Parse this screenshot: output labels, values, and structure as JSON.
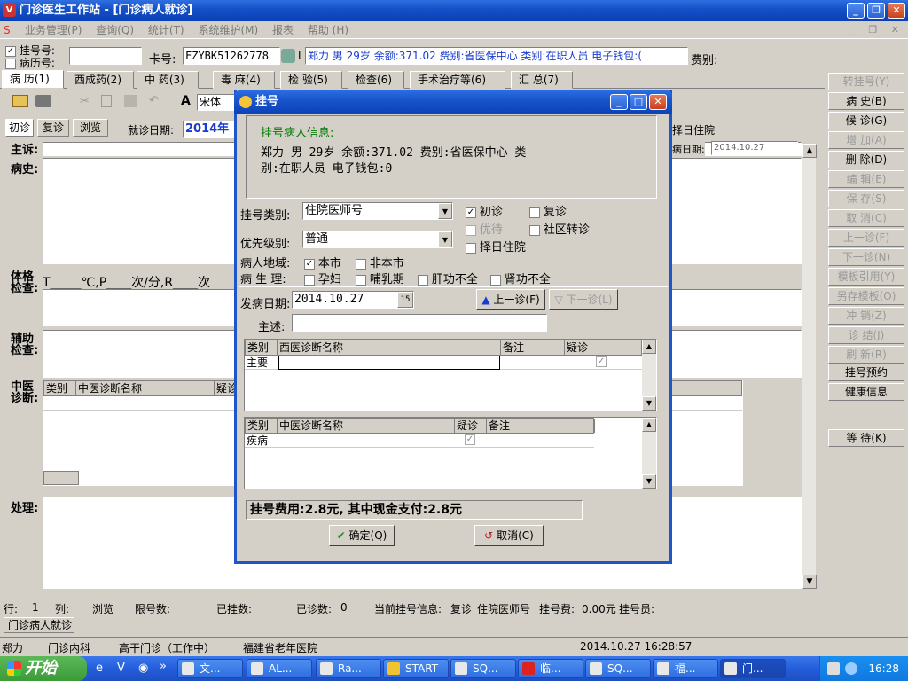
{
  "window": {
    "title": "门诊医生工作站 - [门诊病人就诊]"
  },
  "menu": [
    "业务管理(P)",
    "查询(Q)",
    "统计(T)",
    "系统维护(M)",
    "报表",
    "帮助 (H)"
  ],
  "top": {
    "chk_reg": "挂号号:",
    "chk_record": "病历号:",
    "card_label": "卡号:",
    "card_value": "FZYBK51262778",
    "card_suffix": "I",
    "patient_info": "郑力 男 29岁 余额:371.02 费别:省医保中心 类别:在职人员 电子钱包:(",
    "fee_label": "费别:"
  },
  "tabs": [
    "病 历(1)",
    "西成药(2)",
    "中 药(3)",
    "毒 麻(4)",
    "检 验(5)",
    "检查(6)",
    "手术治疗等(6)",
    "汇 总(7)"
  ],
  "toolbar": {
    "font_name": "宋体"
  },
  "visit": {
    "first": "初诊",
    "return": "复诊",
    "browse": "浏览",
    "date_label": "就诊日期:",
    "date_value": "2014年1",
    "zhuyuan": "择日住院",
    "onset_label": "病日期:",
    "onset_value": "2014.10.27"
  },
  "record": {
    "chief": "主诉:",
    "history": "病史:",
    "physical": "体格检查:",
    "vitals": "T_____℃,P____次/分,R____次",
    "aux": "辅助检查:",
    "tcm": "中医诊断:",
    "tcm_cols": [
      "类别",
      "中医诊断名称",
      "疑诊"
    ],
    "treatment": "处理:"
  },
  "right_buttons": [
    {
      "label": "转挂号(Y)",
      "enabled": false
    },
    {
      "label": "病 史(B)",
      "enabled": true
    },
    {
      "label": "候 诊(G)",
      "enabled": true
    },
    {
      "label": "增 加(A)",
      "enabled": false
    },
    {
      "label": "删 除(D)",
      "enabled": true
    },
    {
      "label": "编 辑(E)",
      "enabled": false
    },
    {
      "label": "保 存(S)",
      "enabled": false
    },
    {
      "label": "取 消(C)",
      "enabled": false
    },
    {
      "label": "上一诊(F)",
      "enabled": false
    },
    {
      "label": "下一诊(N)",
      "enabled": false
    },
    {
      "label": "模板引用(Y)",
      "enabled": false
    },
    {
      "label": "另存模板(O)",
      "enabled": false
    },
    {
      "label": "冲 销(Z)",
      "enabled": false
    },
    {
      "label": "诊 结(J)",
      "enabled": false
    },
    {
      "label": "刷 新(R)",
      "enabled": false
    },
    {
      "label": "挂号预约",
      "enabled": true
    },
    {
      "label": "健康信息",
      "enabled": true
    },
    {
      "label": "等 待(K)",
      "enabled": true
    }
  ],
  "status": {
    "row_label": "行:",
    "row_value": "1",
    "col_label": "列:",
    "mode": "浏览",
    "limit_label": "限号数:",
    "reg_label": "已挂数:",
    "seen_label": "已诊数:",
    "seen_value": "0",
    "cur_label": "当前挂号信息:",
    "cur_value1": "复诊",
    "cur_value2": "住院医师号",
    "fee_label": "挂号费:",
    "fee_value": "0.00元",
    "staff_label": "挂号员:"
  },
  "doc_tab": "门诊病人就诊",
  "footer": {
    "user": "郑力",
    "dept": "门诊内科",
    "room": "高干门诊（工作中）",
    "hospital": "福建省老年医院",
    "datetime": "2014.10.27 16:28:57"
  },
  "taskbar": {
    "start": "开始",
    "items": [
      "文...",
      "AL...",
      "Ra...",
      "START",
      "SQ...",
      "临...",
      "SQ...",
      "福...",
      "门..."
    ],
    "clock": "16:28"
  },
  "dialog": {
    "title": "挂号",
    "info_title": "挂号病人信息:",
    "info_line1": "郑力 男 29岁 余额:371.02 费别:省医保中心 类",
    "info_line2": "别:在职人员 电子钱包:0",
    "type_label": "挂号类别:",
    "type_value": "住院医师号",
    "first": "初诊",
    "revisit": "复诊",
    "priority_wait": "优待",
    "community": "社区转诊",
    "level_label": "优先级别:",
    "level_value": "普通",
    "choose_day": "择日住院",
    "region_label": "病人地域:",
    "region_local": "本市",
    "region_nonlocal": "非本市",
    "physio_label": "病 生 理:",
    "pregnant": "孕妇",
    "lactation": "哺乳期",
    "liver": "肝功不全",
    "kidney": "肾功不全",
    "onset_label": "发病日期:",
    "onset_value": "2014.10.27",
    "prev_btn": "上一诊(F)",
    "next_btn": "下一诊(L)",
    "chief_label": "主述:",
    "west_cols": [
      "类别",
      "西医诊断名称",
      "备注",
      "疑诊"
    ],
    "west_row_type": "主要",
    "tcm_cols": [
      "类别",
      "中医诊断名称",
      "疑诊",
      "备注"
    ],
    "tcm_row_type": "疾病",
    "fee_text": "挂号费用:2.8元, 其中现金支付:2.8元",
    "ok": "确定(Q)",
    "cancel": "取消(C)"
  }
}
